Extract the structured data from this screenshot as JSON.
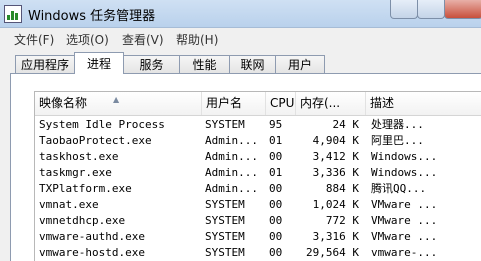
{
  "window": {
    "title": "Windows 任务管理器"
  },
  "menu": [
    "文件(F)",
    "选项(O)",
    "查看(V)",
    "帮助(H)"
  ],
  "tabs": [
    "应用程序",
    "进程",
    "服务",
    "性能",
    "联网",
    "用户"
  ],
  "active_tab": "进程",
  "columns": [
    "映像名称",
    "用户名",
    "CPU",
    "内存(...",
    "描述"
  ],
  "processes": [
    {
      "name": "System Idle Process",
      "user": "SYSTEM",
      "cpu": "95",
      "mem": "24 K",
      "desc": "处理器..."
    },
    {
      "name": "TaobaoProtect.exe",
      "user": "Admin...",
      "cpu": "01",
      "mem": "4,904 K",
      "desc": "阿里巴..."
    },
    {
      "name": "taskhost.exe",
      "user": "Admin...",
      "cpu": "00",
      "mem": "3,412 K",
      "desc": "Windows..."
    },
    {
      "name": "taskmgr.exe",
      "user": "Admin...",
      "cpu": "01",
      "mem": "3,336 K",
      "desc": "Windows..."
    },
    {
      "name": "TXPlatform.exe",
      "user": "Admin...",
      "cpu": "00",
      "mem": "884 K",
      "desc": "腾讯QQ..."
    },
    {
      "name": "vmnat.exe",
      "user": "SYSTEM",
      "cpu": "00",
      "mem": "1,024 K",
      "desc": "VMware ..."
    },
    {
      "name": "vmnetdhcp.exe",
      "user": "SYSTEM",
      "cpu": "00",
      "mem": "772 K",
      "desc": "VMware ..."
    },
    {
      "name": "vmware-authd.exe",
      "user": "SYSTEM",
      "cpu": "00",
      "mem": "3,316 K",
      "desc": "VMware ..."
    },
    {
      "name": "vmware-hostd.exe",
      "user": "SYSTEM",
      "cpu": "00",
      "mem": "29,564 K",
      "desc": "vmware-..."
    }
  ]
}
